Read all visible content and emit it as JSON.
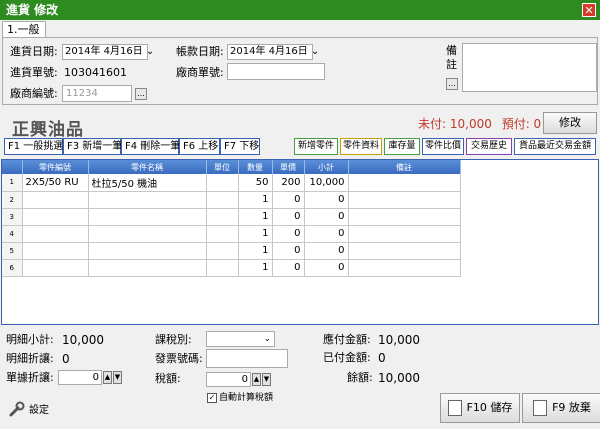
{
  "window": {
    "title": "進貨 修改",
    "close": "✕"
  },
  "tab": {
    "label": "1.一般"
  },
  "form": {
    "purchase_date_label": "進貨日期:",
    "purchase_date_value": "2014年 4月16日 ⌄",
    "purchase_no_label": "進貨單號:",
    "purchase_no_value": "103041601",
    "vendor_code_label": "廠商編號:",
    "vendor_code_value": "11234",
    "vendor_code_button": "...",
    "account_date_label": "帳款日期:",
    "account_date_value": "2014年 4月16日 ⌄",
    "vendor_doc_label": "廠商單號:",
    "vendor_doc_value": "",
    "memo_label": "備註",
    "memo_button": "..."
  },
  "header": {
    "company_name": "正興油品",
    "unpaid": "未付: 10,000",
    "prepaid": "預付: 0",
    "modify_button": "修改"
  },
  "fkeys": [
    "F1 一般挑選",
    "F3 新增一筆",
    "F4 刪除一筆",
    "F6 上移",
    "F7 下移"
  ],
  "right_keys": [
    "新增零件",
    "零件資料",
    "庫存量",
    "零件比價",
    "交易歷史",
    "貨品最近交易金額"
  ],
  "grid": {
    "columns": [
      "零件編號",
      "零件名稱",
      "單位",
      "數量",
      "單價",
      "小計",
      "備註"
    ],
    "rows": [
      {
        "no": "1",
        "part_no": "2X5/50 RU",
        "name": "杜拉5/50 機油",
        "unit": "",
        "qty": "50",
        "price": "200",
        "subtotal": "10,000",
        "note": ""
      },
      {
        "no": "2",
        "part_no": "",
        "name": "",
        "unit": "",
        "qty": "1",
        "price": "0",
        "subtotal": "0",
        "note": ""
      },
      {
        "no": "3",
        "part_no": "",
        "name": "",
        "unit": "",
        "qty": "1",
        "price": "0",
        "subtotal": "0",
        "note": ""
      },
      {
        "no": "4",
        "part_no": "",
        "name": "",
        "unit": "",
        "qty": "1",
        "price": "0",
        "subtotal": "0",
        "note": ""
      },
      {
        "no": "5",
        "part_no": "",
        "name": "",
        "unit": "",
        "qty": "1",
        "price": "0",
        "subtotal": "0",
        "note": ""
      },
      {
        "no": "6",
        "part_no": "",
        "name": "",
        "unit": "",
        "qty": "1",
        "price": "0",
        "subtotal": "0",
        "note": ""
      }
    ]
  },
  "summary": {
    "detail_subtotal_label": "明細小計:",
    "detail_subtotal_value": "10,000",
    "detail_discount_label": "明細折讓:",
    "detail_discount_value": "0",
    "doc_discount_label": "單據折讓:",
    "doc_discount_value": "0",
    "tax_type_label": "課稅別:",
    "tax_type_value": "⌄",
    "invoice_no_label": "發票號碼:",
    "tax_label": "稅額:",
    "tax_value": "0",
    "auto_tax_label": "自動計算稅額",
    "auto_tax_checked": "✓",
    "payable_label": "應付金額:",
    "payable_value": "10,000",
    "paid_label": "已付金額:",
    "paid_value": "0",
    "balance_label": "餘額:",
    "balance_value": "10,000"
  },
  "footer": {
    "settings_label": "設定",
    "save_button": "F10 儲存",
    "cancel_button": "F9 放棄",
    "spin_up": "▲",
    "spin_down": "▼"
  }
}
